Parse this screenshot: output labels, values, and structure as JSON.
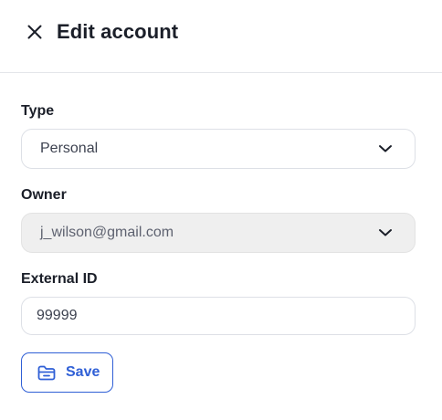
{
  "header": {
    "title": "Edit account"
  },
  "form": {
    "type": {
      "label": "Type",
      "value": "Personal"
    },
    "owner": {
      "label": "Owner",
      "value": "j_wilson@gmail.com"
    },
    "external_id": {
      "label": "External ID",
      "value": "99999"
    },
    "save_label": "Save"
  },
  "colors": {
    "accent": "#2f5fd6",
    "disabled_bg": "#efefef",
    "border": "#dde0e6"
  },
  "icons": {
    "close": "close-icon",
    "chevron": "chevron-down-icon",
    "save": "folder-save-icon"
  }
}
